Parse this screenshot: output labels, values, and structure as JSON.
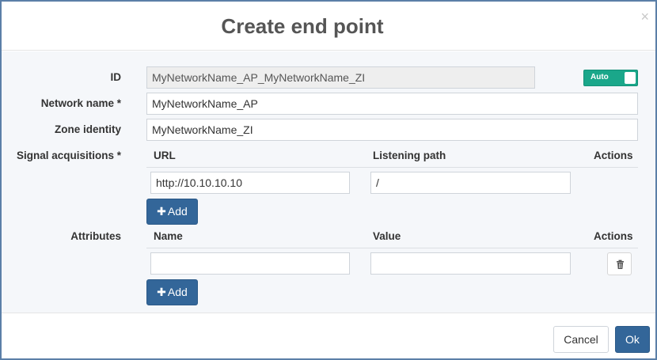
{
  "dialog": {
    "title": "Create end point",
    "close_glyph": "×"
  },
  "form": {
    "id": {
      "label": "ID",
      "value": "MyNetworkName_AP_MyNetworkName_ZI"
    },
    "auto_toggle": {
      "label": "Auto",
      "state": "on",
      "color": "#1aa78a"
    },
    "network_name": {
      "label": "Network name *",
      "value": "MyNetworkName_AP"
    },
    "zone_identity": {
      "label": "Zone identity",
      "value": "MyNetworkName_ZI"
    },
    "signal_acquisitions": {
      "label": "Signal acquisitions *",
      "columns": [
        "URL",
        "Listening path",
        "Actions"
      ],
      "rows": [
        {
          "url": "http://10.10.10.10",
          "listening_path": "/"
        }
      ],
      "add_label": "Add"
    },
    "attributes": {
      "label": "Attributes",
      "columns": [
        "Name",
        "Value",
        "Actions"
      ],
      "rows": [
        {
          "name": "",
          "value": ""
        }
      ],
      "add_label": "Add"
    }
  },
  "footer": {
    "cancel_label": "Cancel",
    "ok_label": "Ok"
  },
  "icons": {
    "close": "close-icon",
    "plus": "plus-icon",
    "delete": "trash-icon"
  },
  "colors": {
    "primary": "#336699",
    "toggle_on": "#1aa78a"
  }
}
